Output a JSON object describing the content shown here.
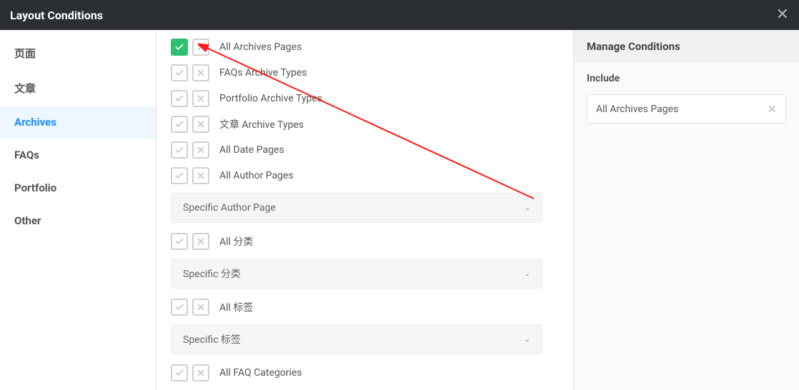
{
  "header": {
    "title": "Layout Conditions"
  },
  "sidebar": {
    "items": [
      {
        "label": "页面",
        "active": false
      },
      {
        "label": "文章",
        "active": false
      },
      {
        "label": "Archives",
        "active": true
      },
      {
        "label": "FAQs",
        "active": false
      },
      {
        "label": "Portfolio",
        "active": false
      },
      {
        "label": "Other",
        "active": false
      }
    ]
  },
  "conditions": [
    {
      "label": "All Archives Pages",
      "include_on": true
    },
    {
      "label": "FAQs Archive Types",
      "include_on": false
    },
    {
      "label": "Portfolio Archive Types",
      "include_on": false
    },
    {
      "label": "文章 Archive Types",
      "include_on": false
    },
    {
      "label": "All Date Pages",
      "include_on": false
    },
    {
      "label": "All Author Pages",
      "include_on": false
    }
  ],
  "selects": [
    {
      "label": "Specific Author Page"
    }
  ],
  "conditions2": [
    {
      "label": "All 分类"
    }
  ],
  "selects2": [
    {
      "label": "Specific 分类"
    }
  ],
  "conditions3": [
    {
      "label": "All 标签"
    }
  ],
  "selects3": [
    {
      "label": "Specific 标签"
    }
  ],
  "conditions4": [
    {
      "label": "All FAQ Categories"
    }
  ],
  "right": {
    "title": "Manage Conditions",
    "include_label": "Include",
    "tags": [
      {
        "label": "All Archives Pages"
      }
    ]
  }
}
